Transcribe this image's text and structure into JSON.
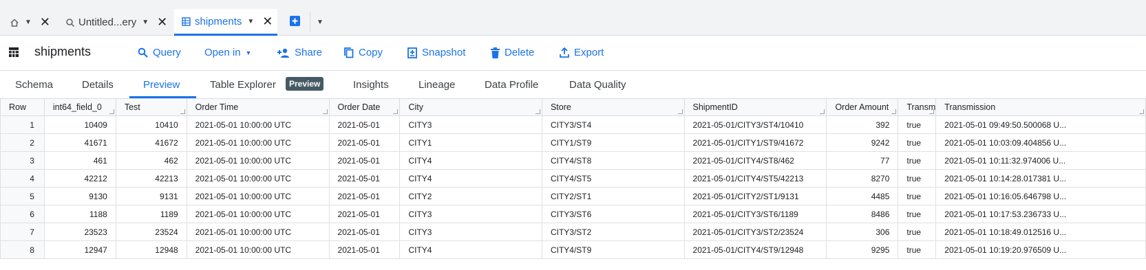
{
  "tabs": [
    {
      "label": "",
      "icon": "home-icon"
    },
    {
      "label": "Untitled...ery",
      "icon": "query-icon"
    },
    {
      "label": "shipments",
      "icon": "table-icon"
    }
  ],
  "toolbar": {
    "title": "shipments",
    "buttons": {
      "query": "Query",
      "open_in": "Open in",
      "share": "Share",
      "copy": "Copy",
      "snapshot": "Snapshot",
      "delete": "Delete",
      "export": "Export"
    }
  },
  "section_tabs": {
    "schema": "Schema",
    "details": "Details",
    "preview": "Preview",
    "table_explorer": "Table Explorer",
    "badge": "Preview",
    "insights": "Insights",
    "lineage": "Lineage",
    "data_profile": "Data Profile",
    "data_quality": "Data Quality"
  },
  "grid": {
    "headers": [
      "Row",
      "int64_field_0",
      "Test",
      "Order Time",
      "Order Date",
      "City",
      "Store",
      "ShipmentID",
      "Order Amount",
      "Transm",
      "Transmission"
    ],
    "rows": [
      [
        "1",
        "10409",
        "10410",
        "2021-05-01 10:00:00 UTC",
        "2021-05-01",
        "CITY3",
        "CITY3/ST4",
        "2021-05-01/CITY3/ST4/10410",
        "392",
        "true",
        "2021-05-01 09:49:50.500068 U..."
      ],
      [
        "2",
        "41671",
        "41672",
        "2021-05-01 10:00:00 UTC",
        "2021-05-01",
        "CITY1",
        "CITY1/ST9",
        "2021-05-01/CITY1/ST9/41672",
        "9242",
        "true",
        "2021-05-01 10:03:09.404856 U..."
      ],
      [
        "3",
        "461",
        "462",
        "2021-05-01 10:00:00 UTC",
        "2021-05-01",
        "CITY4",
        "CITY4/ST8",
        "2021-05-01/CITY4/ST8/462",
        "77",
        "true",
        "2021-05-01 10:11:32.974006 U..."
      ],
      [
        "4",
        "42212",
        "42213",
        "2021-05-01 10:00:00 UTC",
        "2021-05-01",
        "CITY4",
        "CITY4/ST5",
        "2021-05-01/CITY4/ST5/42213",
        "8270",
        "true",
        "2021-05-01 10:14:28.017381 U..."
      ],
      [
        "5",
        "9130",
        "9131",
        "2021-05-01 10:00:00 UTC",
        "2021-05-01",
        "CITY2",
        "CITY2/ST1",
        "2021-05-01/CITY2/ST1/9131",
        "4485",
        "true",
        "2021-05-01 10:16:05.646798 U..."
      ],
      [
        "6",
        "1188",
        "1189",
        "2021-05-01 10:00:00 UTC",
        "2021-05-01",
        "CITY3",
        "CITY3/ST6",
        "2021-05-01/CITY3/ST6/1189",
        "8486",
        "true",
        "2021-05-01 10:17:53.236733 U..."
      ],
      [
        "7",
        "23523",
        "23524",
        "2021-05-01 10:00:00 UTC",
        "2021-05-01",
        "CITY3",
        "CITY3/ST2",
        "2021-05-01/CITY3/ST2/23524",
        "306",
        "true",
        "2021-05-01 10:18:49.012516 U..."
      ],
      [
        "8",
        "12947",
        "12948",
        "2021-05-01 10:00:00 UTC",
        "2021-05-01",
        "CITY4",
        "CITY4/ST9",
        "2021-05-01/CITY4/ST9/12948",
        "9295",
        "true",
        "2021-05-01 10:19:20.976509 U..."
      ]
    ]
  }
}
